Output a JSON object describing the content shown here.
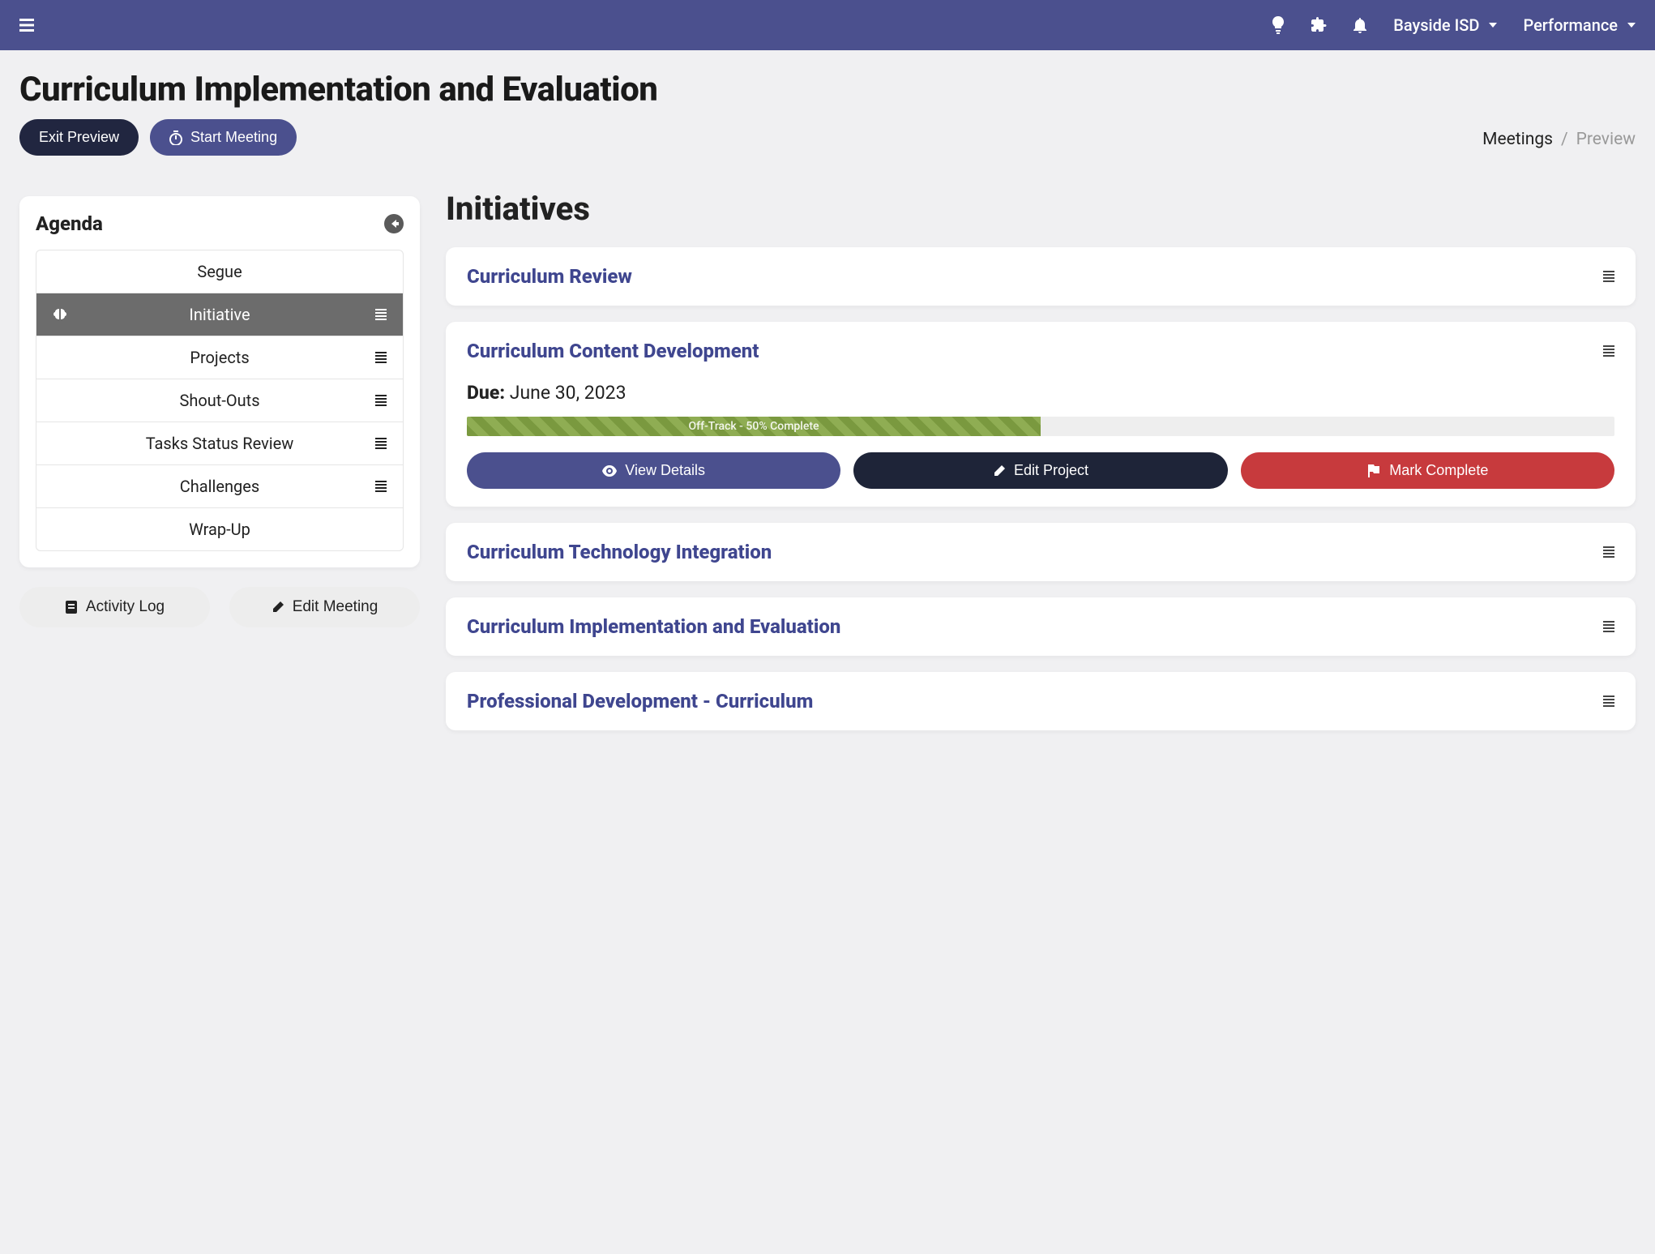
{
  "header": {
    "org_label": "Bayside ISD",
    "module_label": "Performance"
  },
  "page": {
    "title": "Curriculum Implementation and Evaluation",
    "exit_preview_label": "Exit Preview",
    "start_meeting_label": "Start Meeting"
  },
  "breadcrumb": {
    "parent": "Meetings",
    "current": "Preview"
  },
  "agenda": {
    "title": "Agenda",
    "items": [
      {
        "label": "Segue",
        "has_menu": false,
        "active": false
      },
      {
        "label": "Initiative",
        "has_menu": true,
        "active": true
      },
      {
        "label": "Projects",
        "has_menu": true,
        "active": false
      },
      {
        "label": "Shout-Outs",
        "has_menu": true,
        "active": false
      },
      {
        "label": "Tasks Status Review",
        "has_menu": true,
        "active": false
      },
      {
        "label": "Challenges",
        "has_menu": true,
        "active": false
      },
      {
        "label": "Wrap-Up",
        "has_menu": false,
        "active": false
      }
    ],
    "activity_log_label": "Activity Log",
    "edit_meeting_label": "Edit Meeting"
  },
  "initiatives": {
    "section_title": "Initiatives",
    "items": [
      {
        "title": "Curriculum Review",
        "expanded": false
      },
      {
        "title": "Curriculum Content Development",
        "expanded": true,
        "due_label": "Due:",
        "due_date": "June 30, 2023",
        "progress_text": "Off-Track - 50% Complete",
        "progress_pct": 50,
        "view_details_label": "View Details",
        "edit_project_label": "Edit Project",
        "mark_complete_label": "Mark Complete"
      },
      {
        "title": "Curriculum Technology Integration",
        "expanded": false
      },
      {
        "title": "Curriculum Implementation and Evaluation",
        "expanded": false
      },
      {
        "title": "Professional Development - Curriculum",
        "expanded": false
      }
    ]
  }
}
